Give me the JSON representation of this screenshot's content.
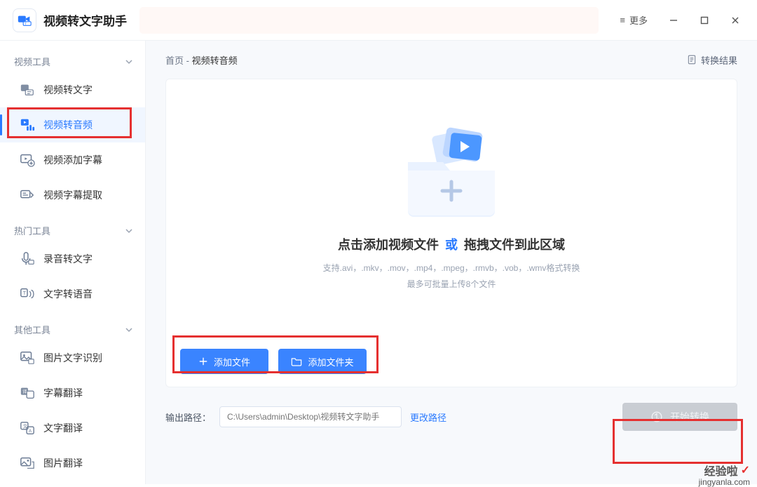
{
  "app": {
    "title": "视频转文字助手",
    "more": "更多"
  },
  "sidebar": {
    "sections": [
      {
        "title": "视频工具",
        "items": [
          "视频转文字",
          "视频转音频",
          "视频添加字幕",
          "视频字幕提取"
        ]
      },
      {
        "title": "热门工具",
        "items": [
          "录音转文字",
          "文字转语音"
        ]
      },
      {
        "title": "其他工具",
        "items": [
          "图片文字识别",
          "字幕翻译",
          "文字翻译",
          "图片翻译"
        ]
      }
    ],
    "active_index": [
      0,
      1
    ]
  },
  "crumbs": {
    "home": "首页",
    "sep": " - ",
    "current": "视频转音频"
  },
  "top_right": {
    "result": "转换结果"
  },
  "drop": {
    "prompt_left": "点击添加视频文件",
    "prompt_or": "或",
    "prompt_right": "拖拽文件到此区域",
    "formats": "支持.avi，.mkv，.mov，.mp4，.mpeg，.rmvb，.vob，.wmv格式转换",
    "limit": "最多可批量上传8个文件",
    "btn_add_file": "添加文件",
    "btn_add_folder": "添加文件夹"
  },
  "output": {
    "label": "输出路径：",
    "path": "C:\\Users\\admin\\Desktop\\视频转文字助手",
    "change": "更改路径"
  },
  "start": {
    "label": "开始转换"
  },
  "watermark": {
    "brand": "经验啦",
    "domain": "jingyanla.com"
  }
}
